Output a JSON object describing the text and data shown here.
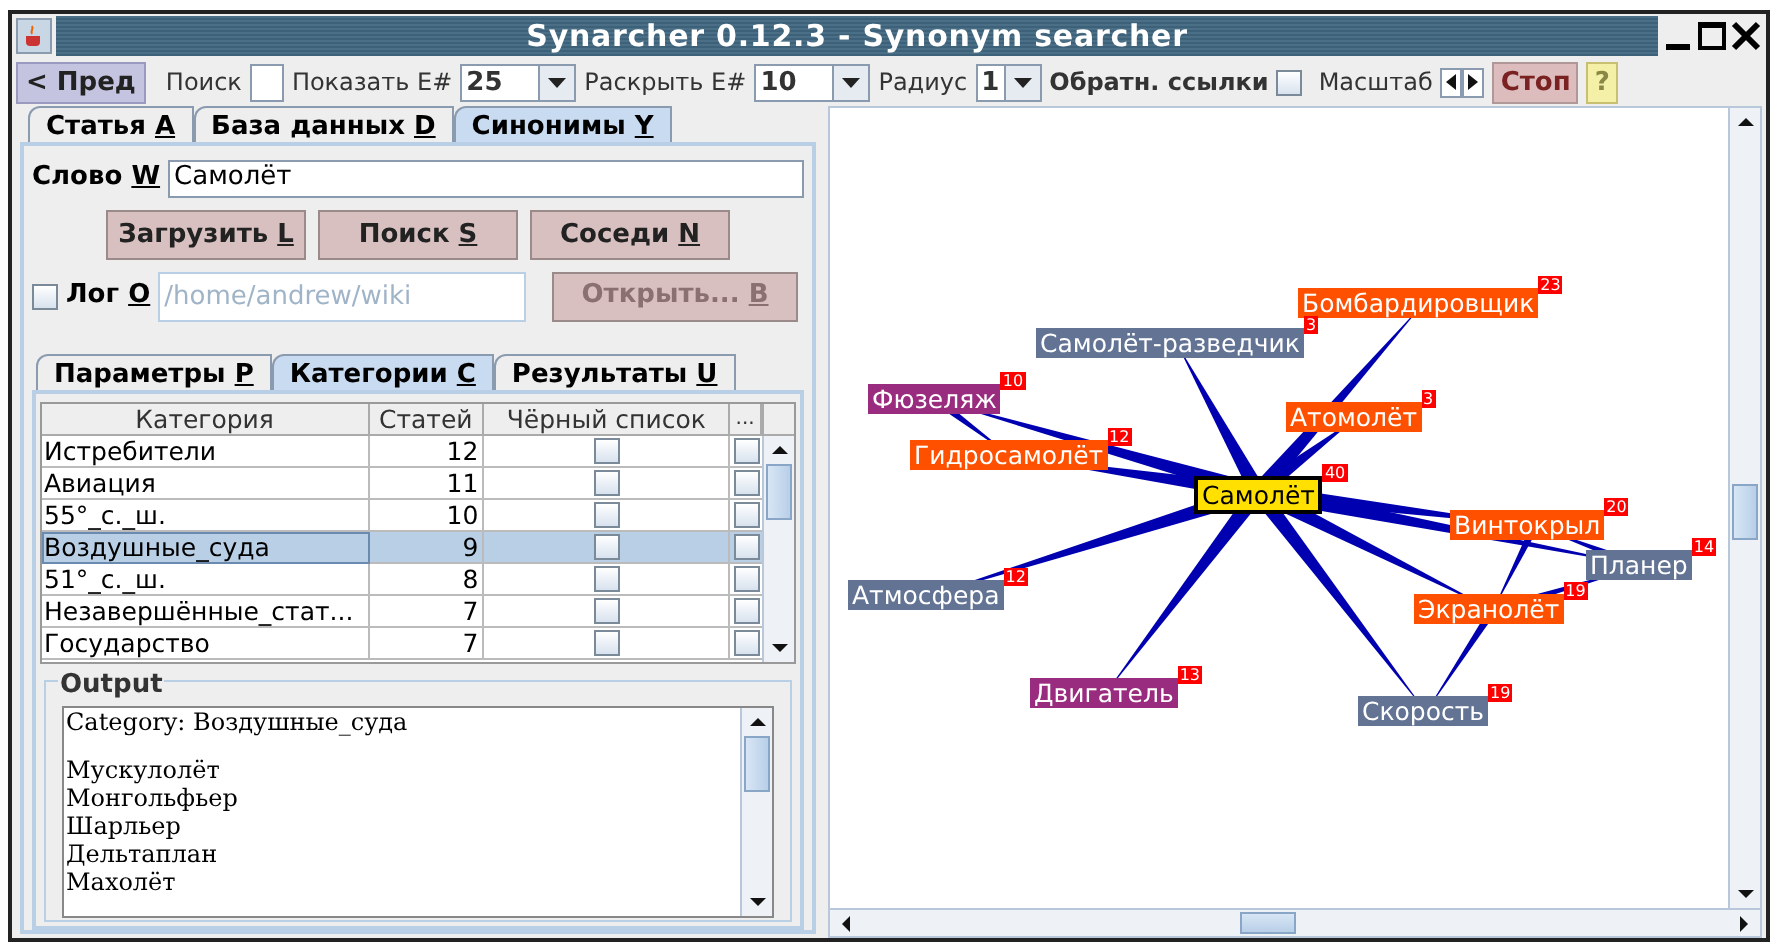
{
  "window": {
    "title": "Synarcher 0.12.3 - Synonym searcher"
  },
  "toolbar": {
    "prev_button": "< Пред",
    "search": {
      "label": "Поиск",
      "checked": false
    },
    "show": {
      "label": "Показать E#",
      "value": "25"
    },
    "expand": {
      "label": "Раскрыть E#",
      "value": "10"
    },
    "radius": {
      "label": "Радиус",
      "value": "1"
    },
    "backlinks": {
      "label": "Обратн. ссылки",
      "checked": false
    },
    "scale": {
      "label": "Масштаб"
    },
    "stop_button": "Стоп",
    "help_button": "?"
  },
  "main_tabs": [
    {
      "label": "Статья",
      "key": "A",
      "selected": false
    },
    {
      "label": "База данных",
      "key": "D",
      "selected": false
    },
    {
      "label": "Синонимы",
      "key": "Y",
      "selected": true
    }
  ],
  "word": {
    "label": "Слово",
    "key": "W",
    "value": "Самолёт"
  },
  "buttons": [
    {
      "label": "Загрузить",
      "key": "L"
    },
    {
      "label": "Поиск",
      "key": "S"
    },
    {
      "label": "Соседи",
      "key": "N"
    }
  ],
  "log": {
    "label": "Лог",
    "key": "O",
    "checked": false,
    "path": "/home/andrew/wiki",
    "path_disabled": true,
    "open_button": {
      "label": "Открыть...",
      "key": "B",
      "disabled": true
    }
  },
  "sub_tabs": [
    {
      "label": "Параметры",
      "key": "P",
      "selected": false
    },
    {
      "label": "Категории",
      "key": "C",
      "selected": true
    },
    {
      "label": "Результаты",
      "key": "U",
      "selected": false
    }
  ],
  "table": {
    "columns": [
      "Категория",
      "Статей",
      "Чёрный список",
      "..."
    ],
    "rows": [
      {
        "category": "Истребители",
        "articles": "12",
        "blacklisted": false,
        "column_4": false,
        "selected": false
      },
      {
        "category": "Авиация",
        "articles": "11",
        "blacklisted": false,
        "column_4": false,
        "selected": false
      },
      {
        "category": "55°_с._ш.",
        "articles": "10",
        "blacklisted": false,
        "column_4": false,
        "selected": false
      },
      {
        "category": "Воздушные_суда",
        "articles": "9",
        "blacklisted": false,
        "column_4": false,
        "selected": true
      },
      {
        "category": "51°_с._ш.",
        "articles": "8",
        "blacklisted": false,
        "column_4": false,
        "selected": false
      },
      {
        "category": "Незавершённые_стат...",
        "articles": "7",
        "blacklisted": false,
        "column_4": false,
        "selected": false
      },
      {
        "category": "Государство",
        "articles": "7",
        "blacklisted": false,
        "column_4": false,
        "selected": false
      }
    ]
  },
  "output": {
    "title": "Output",
    "lines": [
      "Category: Воздушные_суда",
      "Мускулолёт",
      "Монгольфьер",
      "Шарльер",
      "Дельтаплан",
      "Махолёт"
    ]
  },
  "graph": {
    "nodes": [
      {
        "label": "Бомбардировщик",
        "count": "23",
        "color": "#ff5000"
      },
      {
        "label": "Самолёт-разведчик",
        "count": "3",
        "color": "#627394"
      },
      {
        "label": "Фюзеляж",
        "count": "10",
        "color": "#9a2c7f"
      },
      {
        "label": "Атомолёт",
        "count": "3",
        "color": "#ff5000"
      },
      {
        "label": "Гидросамолёт",
        "count": "12",
        "color": "#ff5000"
      },
      {
        "label": "Самолёт",
        "count": "40",
        "color": "#ffe000"
      },
      {
        "label": "Винтокрыл",
        "count": "20",
        "color": "#ff5000"
      },
      {
        "label": "Планер",
        "count": "14",
        "color": "#627394"
      },
      {
        "label": "Атмосфера",
        "count": "12",
        "color": "#627394"
      },
      {
        "label": "Экранолёт",
        "count": "19",
        "color": "#ff5000"
      },
      {
        "label": "Двигатель",
        "count": "13",
        "color": "#9a2c7f"
      },
      {
        "label": "Скорость",
        "count": "19",
        "color": "#627394"
      }
    ]
  }
}
